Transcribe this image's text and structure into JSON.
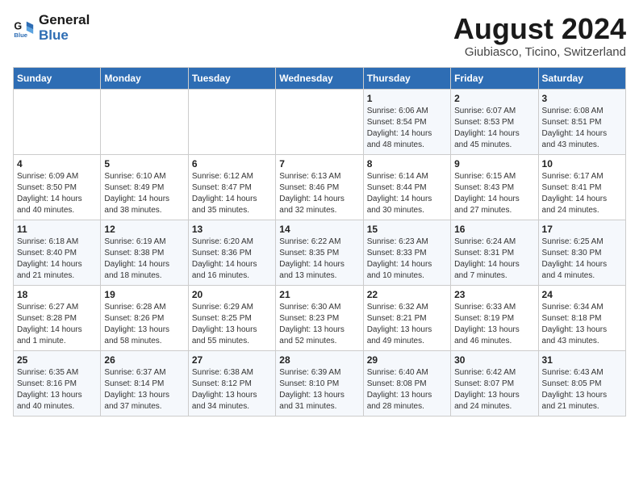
{
  "logo": {
    "text_general": "General",
    "text_blue": "Blue"
  },
  "header": {
    "month_year": "August 2024",
    "location": "Giubiasco, Ticino, Switzerland"
  },
  "days_of_week": [
    "Sunday",
    "Monday",
    "Tuesday",
    "Wednesday",
    "Thursday",
    "Friday",
    "Saturday"
  ],
  "weeks": [
    [
      {
        "day": "",
        "info": ""
      },
      {
        "day": "",
        "info": ""
      },
      {
        "day": "",
        "info": ""
      },
      {
        "day": "",
        "info": ""
      },
      {
        "day": "1",
        "info": "Sunrise: 6:06 AM\nSunset: 8:54 PM\nDaylight: 14 hours and 48 minutes."
      },
      {
        "day": "2",
        "info": "Sunrise: 6:07 AM\nSunset: 8:53 PM\nDaylight: 14 hours and 45 minutes."
      },
      {
        "day": "3",
        "info": "Sunrise: 6:08 AM\nSunset: 8:51 PM\nDaylight: 14 hours and 43 minutes."
      }
    ],
    [
      {
        "day": "4",
        "info": "Sunrise: 6:09 AM\nSunset: 8:50 PM\nDaylight: 14 hours and 40 minutes."
      },
      {
        "day": "5",
        "info": "Sunrise: 6:10 AM\nSunset: 8:49 PM\nDaylight: 14 hours and 38 minutes."
      },
      {
        "day": "6",
        "info": "Sunrise: 6:12 AM\nSunset: 8:47 PM\nDaylight: 14 hours and 35 minutes."
      },
      {
        "day": "7",
        "info": "Sunrise: 6:13 AM\nSunset: 8:46 PM\nDaylight: 14 hours and 32 minutes."
      },
      {
        "day": "8",
        "info": "Sunrise: 6:14 AM\nSunset: 8:44 PM\nDaylight: 14 hours and 30 minutes."
      },
      {
        "day": "9",
        "info": "Sunrise: 6:15 AM\nSunset: 8:43 PM\nDaylight: 14 hours and 27 minutes."
      },
      {
        "day": "10",
        "info": "Sunrise: 6:17 AM\nSunset: 8:41 PM\nDaylight: 14 hours and 24 minutes."
      }
    ],
    [
      {
        "day": "11",
        "info": "Sunrise: 6:18 AM\nSunset: 8:40 PM\nDaylight: 14 hours and 21 minutes."
      },
      {
        "day": "12",
        "info": "Sunrise: 6:19 AM\nSunset: 8:38 PM\nDaylight: 14 hours and 18 minutes."
      },
      {
        "day": "13",
        "info": "Sunrise: 6:20 AM\nSunset: 8:36 PM\nDaylight: 14 hours and 16 minutes."
      },
      {
        "day": "14",
        "info": "Sunrise: 6:22 AM\nSunset: 8:35 PM\nDaylight: 14 hours and 13 minutes."
      },
      {
        "day": "15",
        "info": "Sunrise: 6:23 AM\nSunset: 8:33 PM\nDaylight: 14 hours and 10 minutes."
      },
      {
        "day": "16",
        "info": "Sunrise: 6:24 AM\nSunset: 8:31 PM\nDaylight: 14 hours and 7 minutes."
      },
      {
        "day": "17",
        "info": "Sunrise: 6:25 AM\nSunset: 8:30 PM\nDaylight: 14 hours and 4 minutes."
      }
    ],
    [
      {
        "day": "18",
        "info": "Sunrise: 6:27 AM\nSunset: 8:28 PM\nDaylight: 14 hours and 1 minute."
      },
      {
        "day": "19",
        "info": "Sunrise: 6:28 AM\nSunset: 8:26 PM\nDaylight: 13 hours and 58 minutes."
      },
      {
        "day": "20",
        "info": "Sunrise: 6:29 AM\nSunset: 8:25 PM\nDaylight: 13 hours and 55 minutes."
      },
      {
        "day": "21",
        "info": "Sunrise: 6:30 AM\nSunset: 8:23 PM\nDaylight: 13 hours and 52 minutes."
      },
      {
        "day": "22",
        "info": "Sunrise: 6:32 AM\nSunset: 8:21 PM\nDaylight: 13 hours and 49 minutes."
      },
      {
        "day": "23",
        "info": "Sunrise: 6:33 AM\nSunset: 8:19 PM\nDaylight: 13 hours and 46 minutes."
      },
      {
        "day": "24",
        "info": "Sunrise: 6:34 AM\nSunset: 8:18 PM\nDaylight: 13 hours and 43 minutes."
      }
    ],
    [
      {
        "day": "25",
        "info": "Sunrise: 6:35 AM\nSunset: 8:16 PM\nDaylight: 13 hours and 40 minutes."
      },
      {
        "day": "26",
        "info": "Sunrise: 6:37 AM\nSunset: 8:14 PM\nDaylight: 13 hours and 37 minutes."
      },
      {
        "day": "27",
        "info": "Sunrise: 6:38 AM\nSunset: 8:12 PM\nDaylight: 13 hours and 34 minutes."
      },
      {
        "day": "28",
        "info": "Sunrise: 6:39 AM\nSunset: 8:10 PM\nDaylight: 13 hours and 31 minutes."
      },
      {
        "day": "29",
        "info": "Sunrise: 6:40 AM\nSunset: 8:08 PM\nDaylight: 13 hours and 28 minutes."
      },
      {
        "day": "30",
        "info": "Sunrise: 6:42 AM\nSunset: 8:07 PM\nDaylight: 13 hours and 24 minutes."
      },
      {
        "day": "31",
        "info": "Sunrise: 6:43 AM\nSunset: 8:05 PM\nDaylight: 13 hours and 21 minutes."
      }
    ]
  ]
}
